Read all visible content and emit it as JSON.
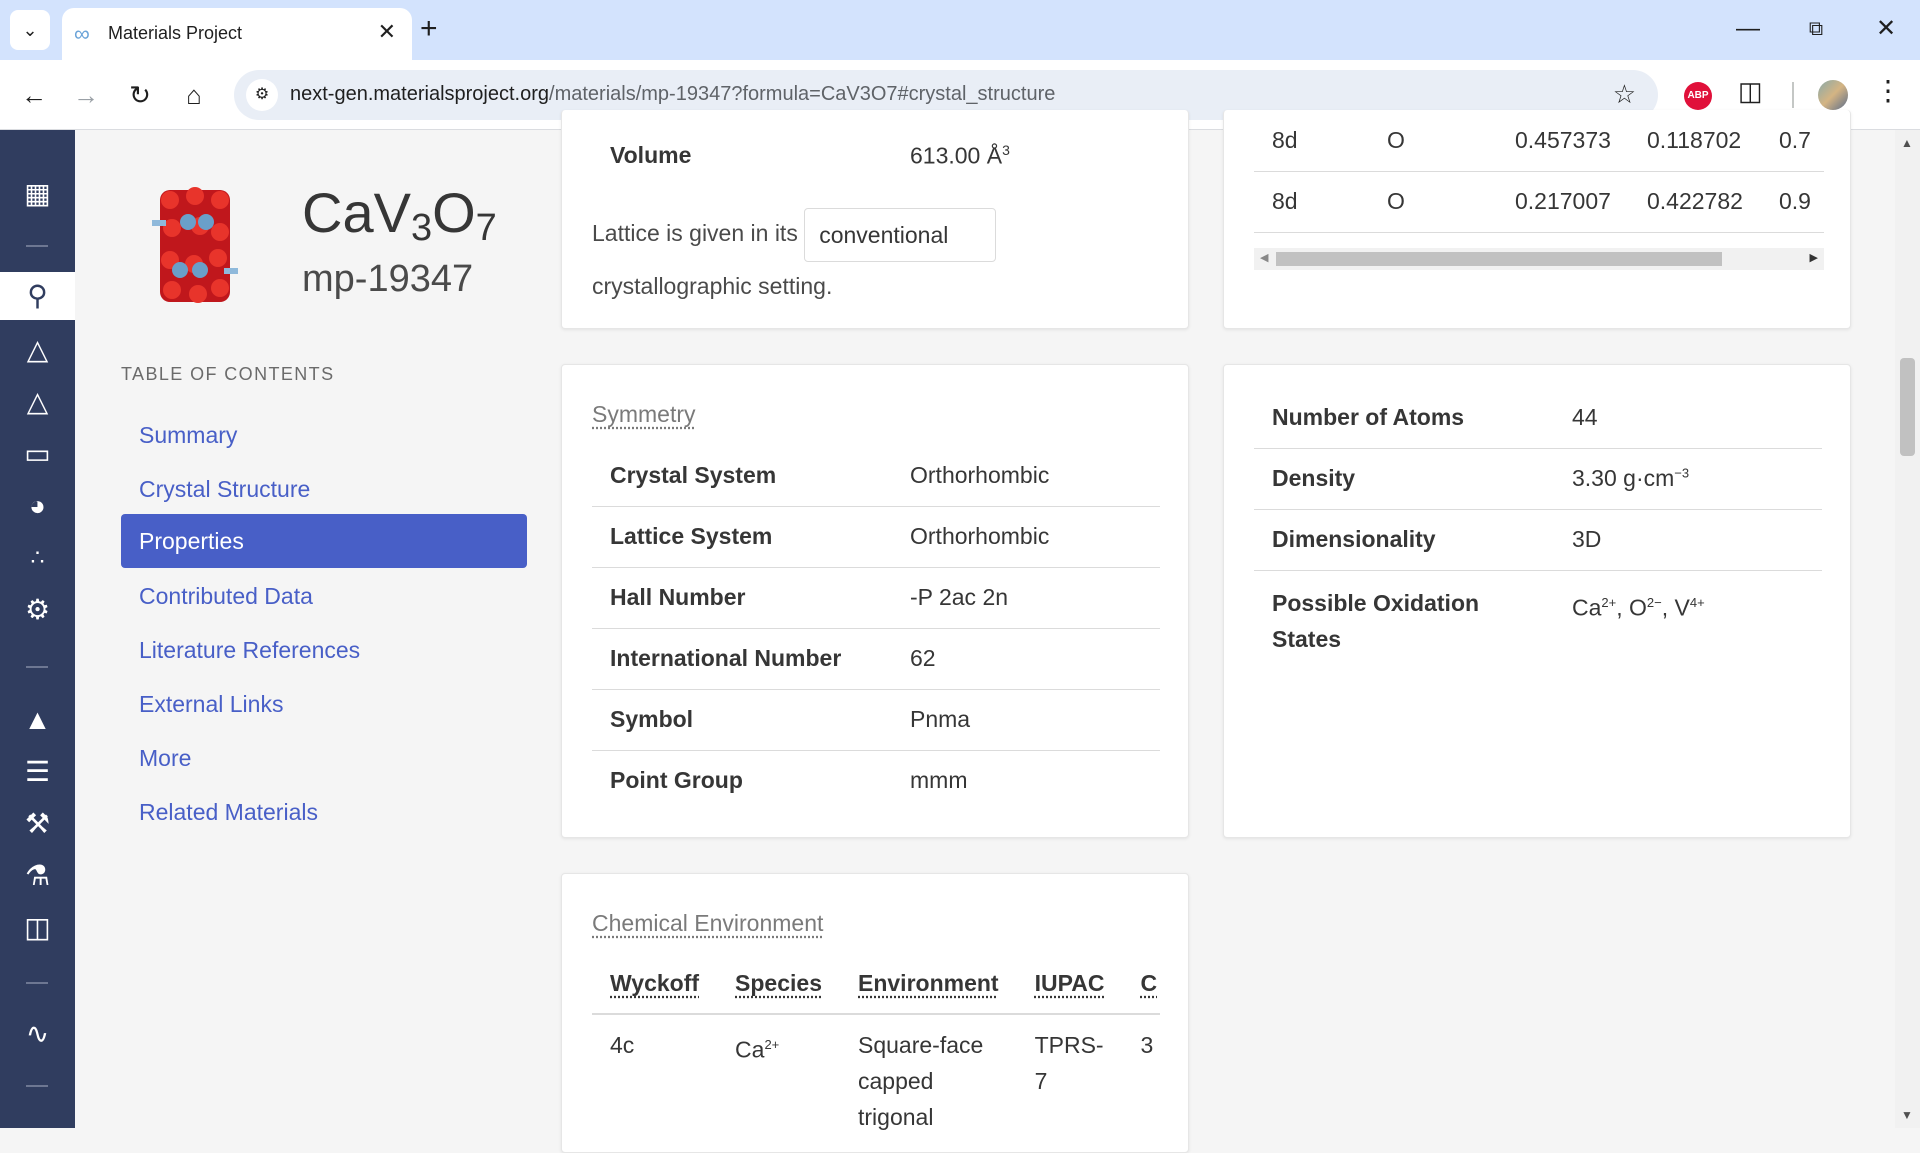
{
  "browser": {
    "tab_title": "Materials Project",
    "url_host": "next-gen.materialsproject.org",
    "url_path": "/materials/mp-19347?formula=CaV3O7#crystal_structure",
    "abp_label": "ABP"
  },
  "material": {
    "formula_parts": [
      "CaV",
      "3",
      "O",
      "7"
    ],
    "id": "mp-19347"
  },
  "toc": {
    "title": "TABLE OF CONTENTS",
    "items": [
      {
        "label": "Summary"
      },
      {
        "label": "Crystal Structure"
      },
      {
        "label": "Properties",
        "active": true
      },
      {
        "label": "Contributed Data"
      },
      {
        "label": "Literature References"
      },
      {
        "label": "External Links"
      },
      {
        "label": "More"
      },
      {
        "label": "Related Materials"
      }
    ]
  },
  "lattice": {
    "volume_label": "Volume",
    "volume_value": "613.00 Å",
    "volume_exp": "3",
    "text_before": "Lattice is given in its",
    "setting": "conventional",
    "text_after": "crystallographic setting."
  },
  "sites": {
    "rows": [
      {
        "wyckoff": "8d",
        "element": "O",
        "x": "0.457373",
        "y": "0.118702",
        "z": "0.7"
      },
      {
        "wyckoff": "8d",
        "element": "O",
        "x": "0.217007",
        "y": "0.422782",
        "z": "0.9"
      }
    ]
  },
  "symmetry": {
    "title": "Symmetry",
    "rows": [
      {
        "label": "Crystal System",
        "value": "Orthorhombic"
      },
      {
        "label": "Lattice System",
        "value": "Orthorhombic"
      },
      {
        "label": "Hall Number",
        "value": "-P 2ac 2n"
      },
      {
        "label": "International Number",
        "value": "62"
      },
      {
        "label": "Symbol",
        "value": "Pnma"
      },
      {
        "label": "Point Group",
        "value": "mmm"
      }
    ]
  },
  "properties": {
    "atoms_label": "Number of Atoms",
    "atoms_value": "44",
    "density_label": "Density",
    "density_value": "3.30 g·cm",
    "density_exp": "−3",
    "dimensionality_label": "Dimensionality",
    "dimensionality_value": "3D",
    "oxidation_label": "Possible Oxidation States",
    "oxidation": [
      {
        "el": "Ca",
        "charge": "2+"
      },
      {
        "el": "O",
        "charge": "2−"
      },
      {
        "el": "V",
        "charge": "4+"
      }
    ]
  },
  "chem_env": {
    "title": "Chemical Environment",
    "headers": [
      "Wyckoff",
      "Species",
      "Environment",
      "IUPAC",
      "C"
    ],
    "row": {
      "wyckoff": "4c",
      "species": "Ca",
      "species_charge": "2+",
      "environment_lines": [
        "Square-face",
        "capped",
        "trigonal"
      ],
      "iupac_lines": [
        "TPRS-",
        "7"
      ],
      "c": "3"
    }
  },
  "icons": {
    "rail": [
      "apps-icon",
      "search-icon",
      "molecule-icon",
      "molecule-alt-icon",
      "battery-icon",
      "mortar-icon",
      "scatter-icon",
      "gear-icon",
      "phase-diagram-icon",
      "pourbaix-icon",
      "tools-icon",
      "flask-icon",
      "book-icon",
      "spectrum-icon"
    ]
  }
}
